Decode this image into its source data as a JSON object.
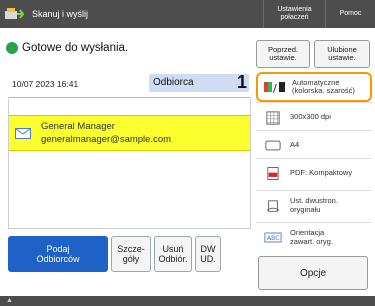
{
  "topbar": {
    "scan_label": "Skanuj i wyślij",
    "settings_label": "Ustawienia\npołaczeń",
    "help_label": "Pomoc"
  },
  "status": {
    "text": "Gotowe do wysłania.",
    "color": "#2aa34a"
  },
  "datetime": "10/07 2023 16:41",
  "destinations": {
    "header_label": "Odbiorca",
    "count": "1",
    "rows": [
      {
        "name": "General Manager",
        "email": "generalmanager@sample.com",
        "icon": "envelope-icon"
      }
    ]
  },
  "buttons": {
    "specify": "Podaj\nOdbiorców",
    "details": "Szcze-\ngóły",
    "delete": "Usuń\nOdbiór.",
    "dw_ud": "DW\nUD."
  },
  "right_panel": {
    "previous_settings": "Poprzed.\nustawie.",
    "favorite_settings": "Ulubione\nustawie.",
    "items": [
      {
        "label": "Automatyczne\n(kolorska. szarość)",
        "icon": "color-mode-icon"
      },
      {
        "label": "300x300 dpi",
        "icon": "resolution-icon"
      },
      {
        "label": "A4",
        "icon": "paper-size-icon"
      },
      {
        "label": "PDF: Kompaktowy",
        "icon": "file-format-icon"
      },
      {
        "label": "Ust. dwustron.\noryginału",
        "icon": "duplex-original-icon"
      },
      {
        "label": "Orientacja\nzawart. oryg.",
        "icon": "orientation-icon"
      }
    ],
    "options_label": "Opcje"
  },
  "colors": {
    "primary_button": "#1e62c8",
    "selected_row": "#fcff2e",
    "highlight_border": "#f59a00",
    "header_bg": "#4d4d4d"
  }
}
